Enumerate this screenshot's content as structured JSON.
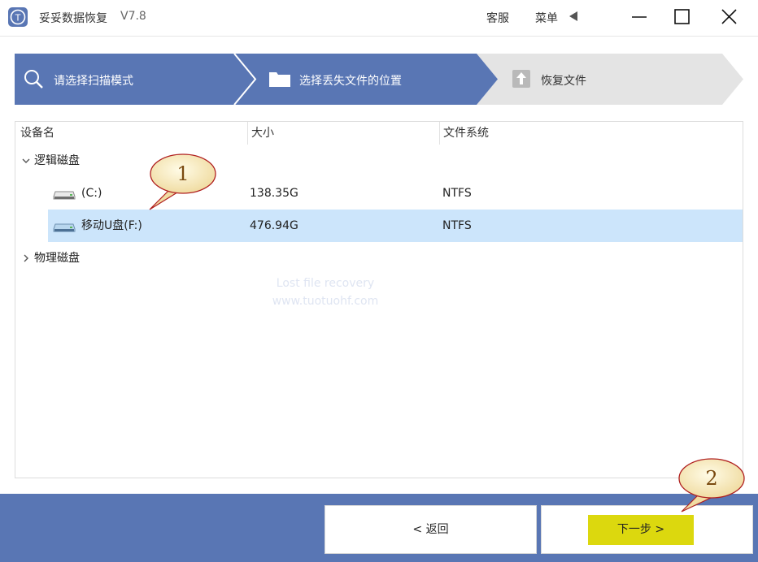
{
  "titlebar": {
    "app_name": "妥妥数据恢复",
    "version": "V7.8",
    "service_label": "客服",
    "menu_label": "菜单",
    "logo_text": "T"
  },
  "steps": [
    {
      "label": "请选择扫描模式",
      "icon": "search-icon",
      "state": "done"
    },
    {
      "label": "选择丢失文件的位置",
      "icon": "folder-icon",
      "state": "active"
    },
    {
      "label": "恢复文件",
      "icon": "upload-icon",
      "state": "pending"
    }
  ],
  "table": {
    "columns": [
      "设备名",
      "大小",
      "文件系统"
    ],
    "groups": [
      {
        "label": "逻辑磁盘",
        "expanded": true,
        "rows": [
          {
            "name": "(C:)",
            "size": "138.35G",
            "fs": "NTFS",
            "selected": false
          },
          {
            "name": "移动U盘(F:)",
            "size": "476.94G",
            "fs": "NTFS",
            "selected": true
          }
        ]
      },
      {
        "label": "物理磁盘",
        "expanded": false,
        "rows": []
      }
    ]
  },
  "watermark": {
    "line1": "Lost file recovery",
    "line2": "www.tuotuohf.com"
  },
  "footer": {
    "back_label": "< 返回",
    "next_label": "下一步 >"
  },
  "callouts": [
    "1",
    "2"
  ],
  "colors": {
    "accent_blue": "#5976b4",
    "step_pending": "#e4e4e4",
    "selected_row": "#cce5fb",
    "next_highlight": "#dcd80e"
  }
}
